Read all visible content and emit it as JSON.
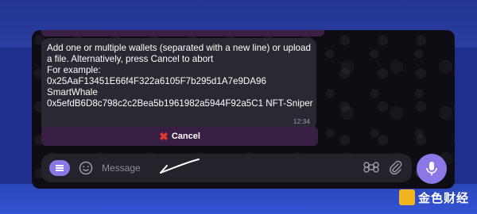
{
  "message": {
    "lines": [
      "Add one or multiple wallets (separated with a new line) or upload",
      "a file. Alternatively, press Cancel to abort",
      "For example:",
      "0x25AaF13451E66f4F322a6105F7b295d1A7e9DA96",
      "SmartWhale",
      "0x5efdB6D8c798c2c2Bea5b1961982a5944F92a5C1 NFT-Sniper"
    ],
    "time": "12:34"
  },
  "cancel_button": {
    "label": "Cancel",
    "icon": "cross-mark-icon"
  },
  "composer": {
    "placeholder": "Message",
    "menu_icon": "menu-icon",
    "emoji_icon": "smiley-icon",
    "command_icon": "command-icon",
    "attach_icon": "paperclip-icon",
    "mic_icon": "microphone-icon"
  },
  "watermark": {
    "text": "金色财经"
  },
  "colors": {
    "accent": "#8b77e6",
    "bubble": "#2a2833",
    "cancel_bar": "#3a1f45",
    "cancel_x": "#e0392f",
    "page_bg": "#1f2f8c"
  }
}
